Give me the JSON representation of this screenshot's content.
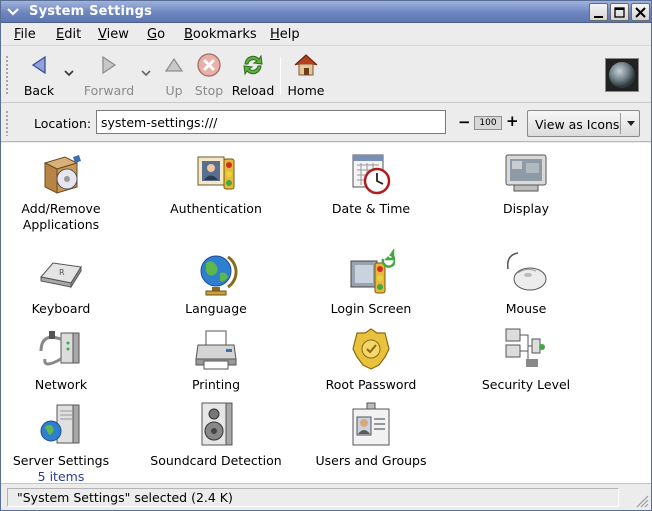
{
  "window": {
    "title": "System Settings"
  },
  "menubar": {
    "items": [
      {
        "label": "File"
      },
      {
        "label": "Edit"
      },
      {
        "label": "View"
      },
      {
        "label": "Go"
      },
      {
        "label": "Bookmarks"
      },
      {
        "label": "Help"
      }
    ]
  },
  "toolbar": {
    "back": "Back",
    "forward": "Forward",
    "up": "Up",
    "stop": "Stop",
    "reload": "Reload",
    "home": "Home"
  },
  "location": {
    "label": "Location:",
    "value": "system-settings:///",
    "zoom_level": "100",
    "zoom_minus": "−",
    "zoom_plus": "+",
    "view_mode": "View as Icons"
  },
  "items": [
    {
      "name": "Add/Remove\nApplications",
      "icon": "package-icon"
    },
    {
      "name": "Authentication",
      "icon": "authentication-icon"
    },
    {
      "name": "Date & Time",
      "icon": "calendar-clock-icon"
    },
    {
      "name": "Display",
      "icon": "display-icon"
    },
    {
      "name": "Keyboard",
      "icon": "keyboard-icon"
    },
    {
      "name": "Language",
      "icon": "globe-icon"
    },
    {
      "name": "Login Screen",
      "icon": "login-screen-icon"
    },
    {
      "name": "Mouse",
      "icon": "mouse-icon"
    },
    {
      "name": "Network",
      "icon": "network-icon"
    },
    {
      "name": "Printing",
      "icon": "printer-icon"
    },
    {
      "name": "Root Password",
      "icon": "badge-icon"
    },
    {
      "name": "Security Level",
      "icon": "security-level-icon"
    },
    {
      "name": "Server Settings",
      "sub": "5 items",
      "icon": "server-globe-icon"
    },
    {
      "name": "Soundcard Detection",
      "icon": "speaker-icon"
    },
    {
      "name": "Users and Groups",
      "icon": "user-card-icon"
    }
  ],
  "status": {
    "text": "\"System Settings\" selected (2.4 K)"
  },
  "colors": {
    "titlebar": "#6e86bf",
    "accent": "#2a3f8f",
    "background": "#ffffff"
  }
}
